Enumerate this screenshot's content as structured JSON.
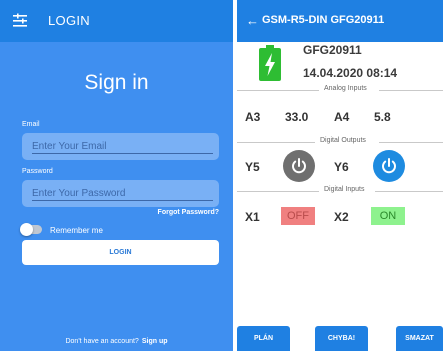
{
  "login_screen": {
    "appbar": {
      "title": "LOGIN",
      "icon": "menu-icon"
    },
    "heading": "Sign in",
    "email": {
      "label": "Email",
      "placeholder": "Enter Your Email",
      "value": ""
    },
    "password": {
      "label": "Password",
      "placeholder": "Enter Your Password",
      "value": ""
    },
    "forgot_link": "Forgot Password?",
    "remember_me": {
      "label": "Remember me",
      "checked": false
    },
    "login_button": "LOGIN",
    "signup": {
      "prompt": "Don't have an account?",
      "link": "Sign up"
    }
  },
  "device_screen": {
    "appbar": {
      "title": "GSM-R5-DIN GFG20911",
      "back_icon": "←"
    },
    "battery_icon": "battery-charging-icon",
    "device_name": "GFG20911",
    "timestamp": "14.04.2020 08:14",
    "sections": {
      "analog": "Analog Inputs",
      "digital_outputs": "Digital Outputs",
      "digital_inputs": "Digital Inputs"
    },
    "analog_inputs": [
      {
        "name": "A3",
        "value": "33.0"
      },
      {
        "name": "A4",
        "value": "5.8"
      }
    ],
    "digital_outputs": [
      {
        "name": "Y5",
        "state": "off"
      },
      {
        "name": "Y6",
        "state": "on"
      }
    ],
    "digital_inputs": [
      {
        "name": "X1",
        "state": "OFF"
      },
      {
        "name": "X2",
        "state": "ON"
      }
    ],
    "buttons": {
      "plan": "PLÁN",
      "errors": "CHYBA!",
      "clear": "SMAZAT"
    }
  },
  "colors": {
    "primary": "#1f80e2",
    "login_background": "#3f8ff0",
    "battery_green": "#2ebd33",
    "power_on": "#1e8be0",
    "power_off": "#6f6f6f",
    "state_off": "#f08080",
    "state_on": "#8ef28e"
  }
}
